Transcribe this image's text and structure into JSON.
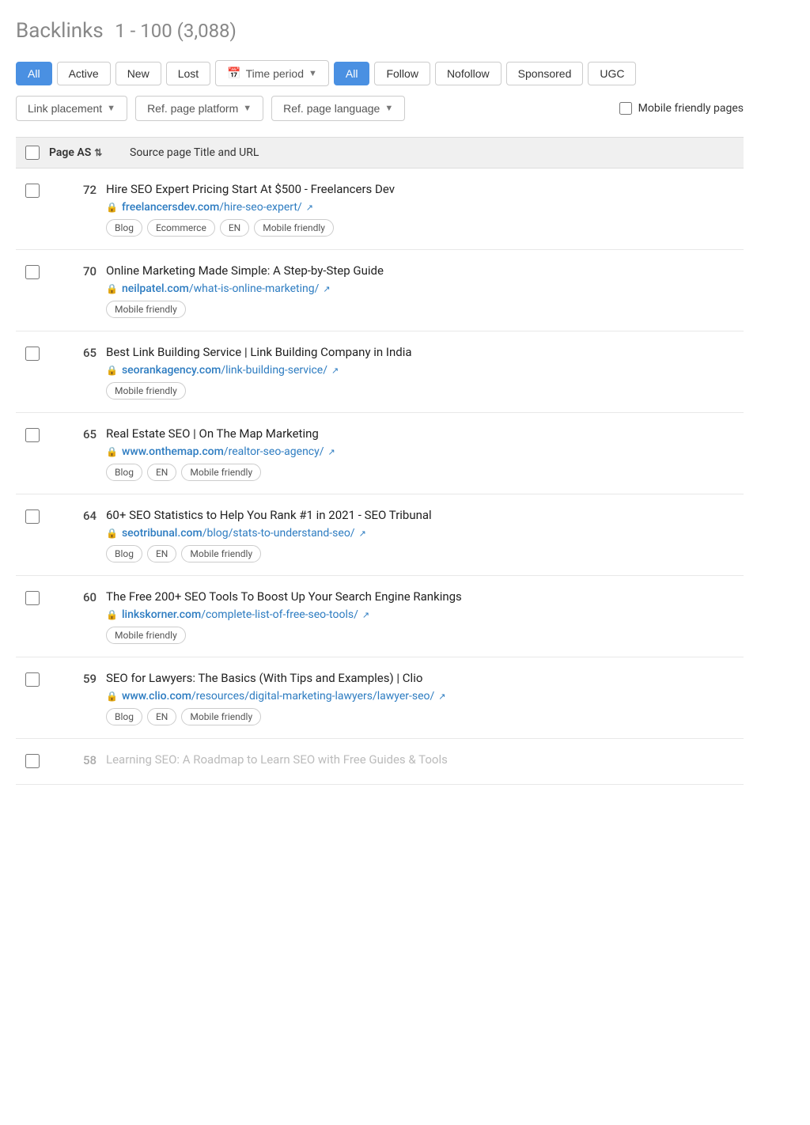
{
  "header": {
    "title": "Backlinks",
    "range": "1 - 100 (3,088)"
  },
  "filters_row1": {
    "status_buttons": [
      {
        "id": "all-status",
        "label": "All",
        "selected": true
      },
      {
        "id": "active-status",
        "label": "Active",
        "selected": false
      },
      {
        "id": "new-status",
        "label": "New",
        "selected": false
      },
      {
        "id": "lost-status",
        "label": "Lost",
        "selected": false
      }
    ],
    "time_period_label": "Time period",
    "link_type_buttons": [
      {
        "id": "all-type",
        "label": "All",
        "selected": true
      },
      {
        "id": "follow-type",
        "label": "Follow",
        "selected": false
      },
      {
        "id": "nofollow-type",
        "label": "Nofollow",
        "selected": false
      },
      {
        "id": "sponsored-type",
        "label": "Sponsored",
        "selected": false
      },
      {
        "id": "ugc-type",
        "label": "UGC",
        "selected": false
      }
    ]
  },
  "filters_row2": {
    "link_placement_label": "Link placement",
    "ref_page_platform_label": "Ref. page platform",
    "ref_page_language_label": "Ref. page language",
    "mobile_friendly_label": "Mobile friendly pages"
  },
  "table": {
    "header_page_as": "Page AS",
    "header_source": "Source page Title and URL"
  },
  "rows": [
    {
      "score": "72",
      "title": "Hire SEO Expert Pricing Start At $500 - Freelancers Dev",
      "url_domain": "freelancersdev.com",
      "url_path": "/hire-seo-expert/",
      "url_full": "freelancersdev.com/hire-seo-expert/",
      "tags": [
        "Blog",
        "Ecommerce",
        "EN",
        "Mobile friendly"
      ],
      "faded": false
    },
    {
      "score": "70",
      "title": "Online Marketing Made Simple: A Step-by-Step Guide",
      "url_domain": "neilpatel.com",
      "url_path": "/what-is-online-marketing/",
      "url_full": "neilpatel.com/what-is-online-marketing/",
      "tags": [
        "Mobile friendly"
      ],
      "faded": false
    },
    {
      "score": "65",
      "title": "Best Link Building Service | Link Building Company in India",
      "url_domain": "seorankagency.com",
      "url_path": "/link-building-service/",
      "url_full": "seorankagency.com/link-building-service/",
      "tags": [
        "Mobile friendly"
      ],
      "faded": false
    },
    {
      "score": "65",
      "title": "Real Estate SEO | On The Map Marketing",
      "url_domain": "www.onthemap.com",
      "url_path": "/realtor-seo-agency/",
      "url_full": "www.onthemap.com/realtor-seo-agency/",
      "tags": [
        "Blog",
        "EN",
        "Mobile friendly"
      ],
      "faded": false
    },
    {
      "score": "64",
      "title": "60+ SEO Statistics to Help You Rank #1 in 2021 - SEO Tribunal",
      "url_domain": "seotribunal.com",
      "url_path": "/blog/stats-to-understand-seo/",
      "url_full": "seotribunal.com/blog/stats-to-understand-seo/",
      "tags": [
        "Blog",
        "EN",
        "Mobile friendly"
      ],
      "faded": false
    },
    {
      "score": "60",
      "title": "The Free 200+ SEO Tools To Boost Up Your Search Engine Rankings",
      "url_domain": "linkskorner.com",
      "url_path": "/complete-list-of-free-seo-tools/",
      "url_full": "linkskorner.com/complete-list-of-free-seo-tools/",
      "tags": [
        "Mobile friendly"
      ],
      "faded": false
    },
    {
      "score": "59",
      "title": "SEO for Lawyers: The Basics (With Tips and Examples) | Clio",
      "url_domain": "www.clio.com",
      "url_path": "/resources/digital-marketing-lawyers/lawyer-seo/",
      "url_full": "www.clio.com/resources/digital-marketing-lawyers/lawyer-seo/",
      "tags": [
        "Blog",
        "EN",
        "Mobile friendly"
      ],
      "faded": false
    },
    {
      "score": "58",
      "title": "Learning SEO: A Roadmap to Learn SEO with Free Guides & Tools",
      "url_domain": "",
      "url_path": "",
      "url_full": "",
      "tags": [],
      "faded": true
    }
  ]
}
